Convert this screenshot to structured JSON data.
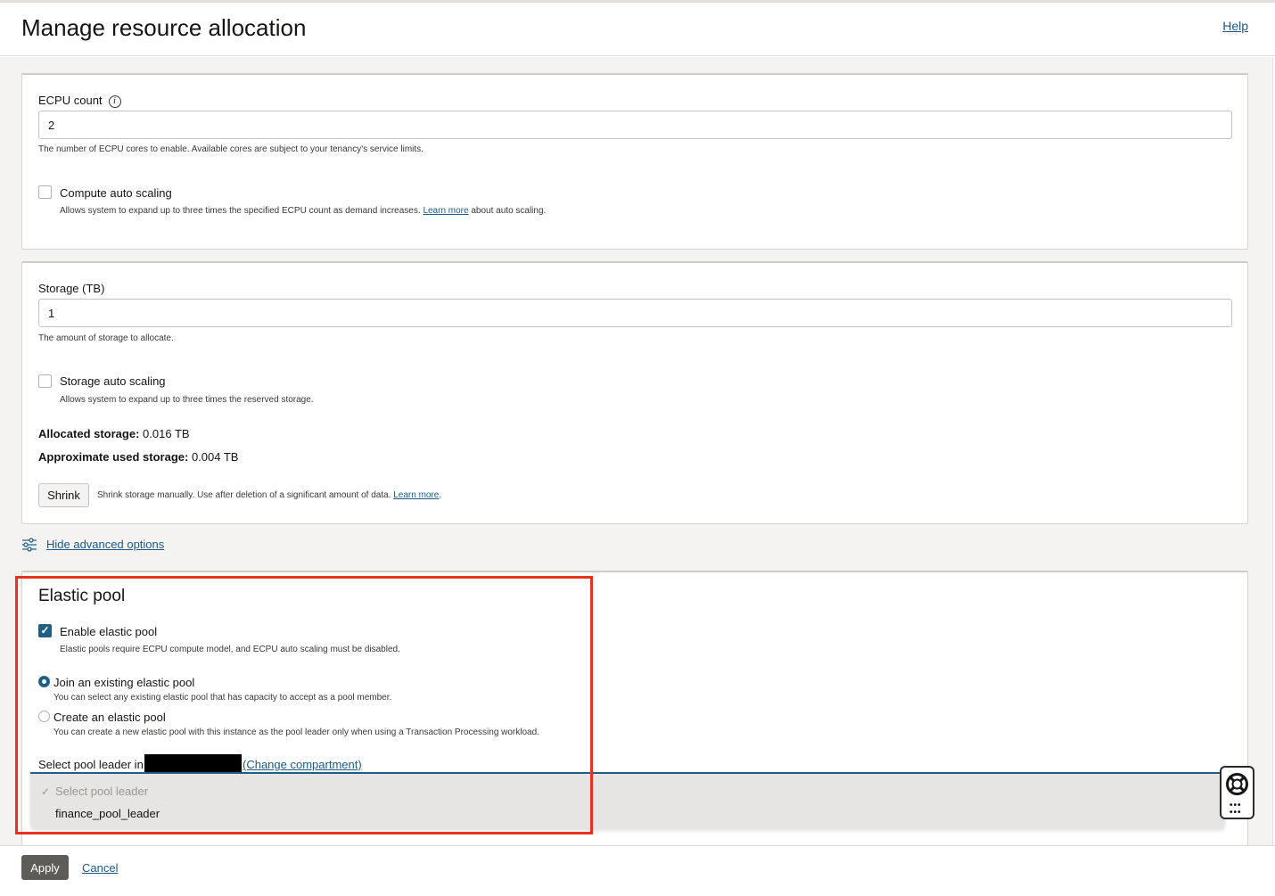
{
  "header": {
    "title": "Manage resource allocation",
    "help": "Help"
  },
  "ecpu": {
    "label": "ECPU count",
    "info_icon": "info-icon",
    "value": "2",
    "hint": "The number of ECPU cores to enable. Available cores are subject to your tenancy's service limits.",
    "autoscale_label": "Compute auto scaling",
    "autoscale_checked": false,
    "autoscale_hint_pre": "Allows system to expand up to three times the specified ECPU count as demand increases.",
    "autoscale_hint_link": "Learn more",
    "autoscale_hint_post": "about auto scaling."
  },
  "storage": {
    "label": "Storage (TB)",
    "value": "1",
    "hint": "The amount of storage to allocate.",
    "autoscale_label": "Storage auto scaling",
    "autoscale_checked": false,
    "autoscale_hint": "Allows system to expand up to three times the reserved storage.",
    "allocated_label": "Allocated storage:",
    "allocated_value": "0.016 TB",
    "used_label": "Approximate used storage:",
    "used_value": "0.004 TB",
    "shrink_label": "Shrink",
    "shrink_hint_pre": "Shrink storage manually. Use after deletion of a significant amount of data.",
    "shrink_hint_link": "Learn more"
  },
  "advanced": {
    "link": "Hide advanced options",
    "icon": "sliders-icon"
  },
  "elastic_pool": {
    "title": "Elastic pool",
    "enable_label": "Enable elastic pool",
    "enable_checked": true,
    "enable_hint": "Elastic pools require ECPU compute model, and ECPU auto scaling must be disabled.",
    "options": [
      {
        "label": "Join an existing elastic pool",
        "hint": "You can select any existing elastic pool that has capacity to accept as a pool member.",
        "selected": true
      },
      {
        "label": "Create an elastic pool",
        "hint": "You can create a new elastic pool with this instance as the pool leader only when using a Transaction Processing workload.",
        "selected": false
      }
    ],
    "pool_leader_label": "Select pool leader in",
    "change_compartment": "(Change compartment)",
    "dropdown": {
      "placeholder": "Select pool leader",
      "items": [
        "finance_pool_leader"
      ]
    }
  },
  "footer": {
    "apply": "Apply",
    "cancel": "Cancel"
  },
  "colors": {
    "accent": "#1f5f86",
    "link": "#1a5b8a",
    "highlight": "#e8321f"
  }
}
